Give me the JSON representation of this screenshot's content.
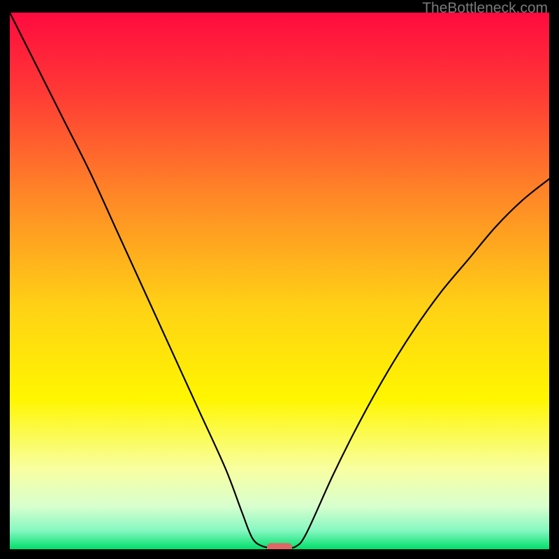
{
  "watermark": "TheBottleneck.com",
  "chart_data": {
    "type": "line",
    "title": "",
    "xlabel": "",
    "ylabel": "",
    "xlim": [
      0,
      100
    ],
    "ylim": [
      0,
      100
    ],
    "series": [
      {
        "name": "bottleneck-curve",
        "x": [
          0,
          5,
          10,
          15,
          20,
          25,
          30,
          35,
          40,
          43,
          45,
          47,
          49,
          51,
          53,
          55,
          60,
          65,
          70,
          75,
          80,
          85,
          90,
          95,
          100
        ],
        "values": [
          100,
          90,
          80,
          70,
          59,
          48,
          37,
          26,
          15,
          7,
          2,
          0.5,
          0.3,
          0.3,
          0.5,
          3,
          14,
          24,
          33,
          41,
          48,
          54,
          60,
          65,
          69
        ]
      }
    ],
    "marker": {
      "x": 50,
      "y": 0.3,
      "color": "#e06666"
    },
    "background_gradient": {
      "stops": [
        {
          "offset": 0.0,
          "color": "#ff0a3f"
        },
        {
          "offset": 0.15,
          "color": "#ff3a35"
        },
        {
          "offset": 0.35,
          "color": "#ff8a26"
        },
        {
          "offset": 0.55,
          "color": "#ffd215"
        },
        {
          "offset": 0.72,
          "color": "#fff600"
        },
        {
          "offset": 0.85,
          "color": "#f8ffa0"
        },
        {
          "offset": 0.92,
          "color": "#d8ffce"
        },
        {
          "offset": 0.965,
          "color": "#86f7c1"
        },
        {
          "offset": 1.0,
          "color": "#00e06a"
        }
      ]
    }
  }
}
